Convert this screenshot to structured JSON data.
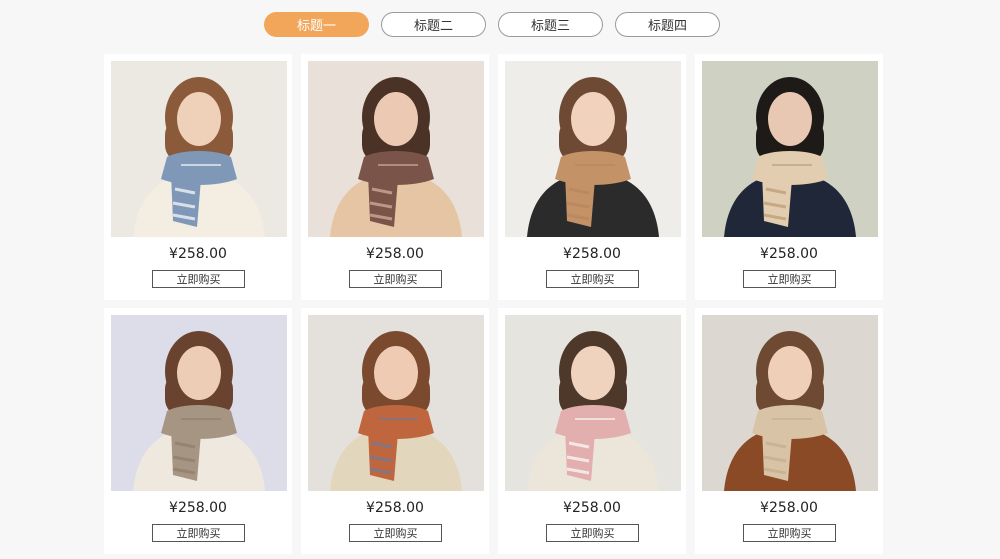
{
  "tabs": [
    {
      "label": "标题一",
      "active": true
    },
    {
      "label": "标题二",
      "active": false
    },
    {
      "label": "标题三",
      "active": false
    },
    {
      "label": "标题四",
      "active": false
    }
  ],
  "products": [
    {
      "price": "¥258.00",
      "buy_label": "立即购买",
      "bg": "#ece8e2",
      "hair": "#8a5a3a",
      "skin": "#efd0b8",
      "top": "#f3ede2",
      "scarf": "#7f98b8",
      "accent": "#ffffff"
    },
    {
      "price": "¥258.00",
      "buy_label": "立即购买",
      "bg": "#e9e1d9",
      "hair": "#4a3326",
      "skin": "#ecc9b2",
      "top": "#e6c5a5",
      "scarf": "#7a5448",
      "accent": "#d9b2a3"
    },
    {
      "price": "¥258.00",
      "buy_label": "立即购买",
      "bg": "#efedea",
      "hair": "#6e4a34",
      "skin": "#f0d2bd",
      "top": "#2b2b2b",
      "scarf": "#c49267",
      "accent": "#b9855c"
    },
    {
      "price": "¥258.00",
      "buy_label": "立即购买",
      "bg": "#cfd1c2",
      "hair": "#1e1a18",
      "skin": "#e8c8b2",
      "top": "#1f2738",
      "scarf": "#e3cdb0",
      "accent": "#b99a76"
    },
    {
      "price": "¥258.00",
      "buy_label": "立即购买",
      "bg": "#dcdde8",
      "hair": "#6a4330",
      "skin": "#eecdb6",
      "top": "#efe8df",
      "scarf": "#a69583",
      "accent": "#8e7d6c"
    },
    {
      "price": "¥258.00",
      "buy_label": "立即购买",
      "bg": "#e4e1dc",
      "hair": "#7b4a2e",
      "skin": "#eecbb2",
      "top": "#e2d6bc",
      "scarf": "#c0663e",
      "accent": "#6b7b9c"
    },
    {
      "price": "¥258.00",
      "buy_label": "立即购买",
      "bg": "#e6e4df",
      "hair": "#4e3829",
      "skin": "#efd3bf",
      "top": "#ece6da",
      "scarf": "#e2aeae",
      "accent": "#ffffff"
    },
    {
      "price": "¥258.00",
      "buy_label": "立即购买",
      "bg": "#dcd8d1",
      "hair": "#6e4a32",
      "skin": "#f0cfb8",
      "top": "#8a4a26",
      "scarf": "#d9c3a6",
      "accent": "#c4ab8c"
    }
  ]
}
